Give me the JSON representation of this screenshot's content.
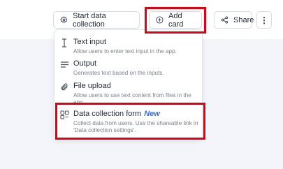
{
  "toolbar": {
    "start_label": "Start data collection",
    "add_label": "Add card",
    "share_label": "Share",
    "more_label": "⋮"
  },
  "menu": {
    "items": [
      {
        "title": "Text input",
        "description": "Allow users to enter text input in the app.",
        "icon": "text-cursor-icon"
      },
      {
        "title": "Output",
        "description": "Generates text based on the inputs.",
        "icon": "lines-icon"
      },
      {
        "title": "File upload",
        "description": "Allow users to use text content from files in the app.",
        "icon": "paperclip-icon"
      },
      {
        "title": "Data collection form",
        "badge": "New",
        "description": "Collect data from users. Use the shareable link in 'Data collection settings'.",
        "icon": "form-icon"
      }
    ]
  },
  "colors": {
    "highlight": "#e0000f",
    "new_badge": "#2f6fe0",
    "background_band": "#f3f5fa"
  }
}
